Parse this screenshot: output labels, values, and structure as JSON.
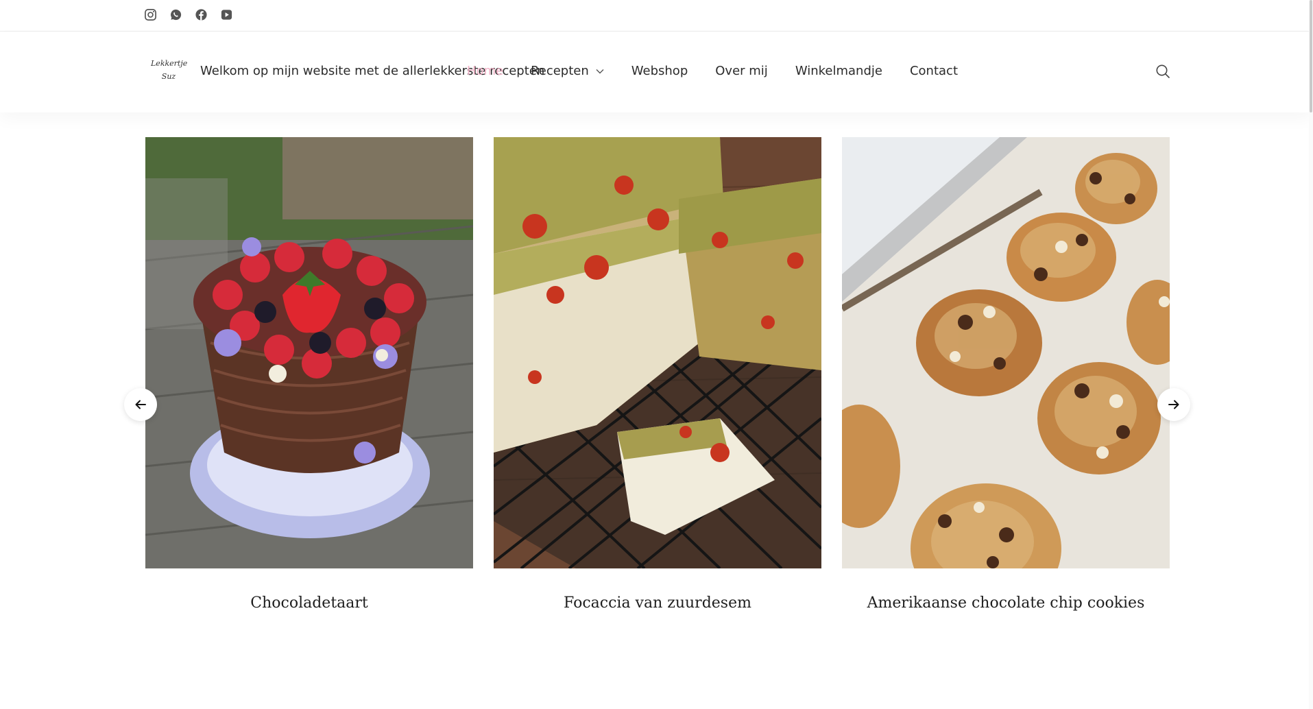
{
  "social": {
    "icons": [
      "instagram-icon",
      "whatsapp-icon",
      "facebook-icon",
      "youtube-icon"
    ]
  },
  "header": {
    "logo_line1": "Lekkertje",
    "logo_line2": "Suz",
    "tagline": "Welkom op mijn website met de allerlekkerste recepten"
  },
  "nav": {
    "items": [
      {
        "label": "Home",
        "active": true
      },
      {
        "label": "Recepten",
        "dropdown": true
      },
      {
        "label": "Webshop"
      },
      {
        "label": "Over mij"
      },
      {
        "label": "Winkelmandje"
      },
      {
        "label": "Contact"
      }
    ],
    "search_icon": "search-icon"
  },
  "colors": {
    "accent": "#f2b3c8",
    "text": "#2b2b2b"
  },
  "carousel": {
    "cards": [
      {
        "title": "Chocoladetaart",
        "image": "chocolate-cake-with-berries"
      },
      {
        "title": "Focaccia van zuurdesem",
        "image": "sourdough-focaccia"
      },
      {
        "title": "Amerikaanse chocolate chip cookies",
        "image": "chocolate-chip-cookies"
      }
    ],
    "prev_icon": "arrow-left-icon",
    "next_icon": "arrow-right-icon"
  }
}
